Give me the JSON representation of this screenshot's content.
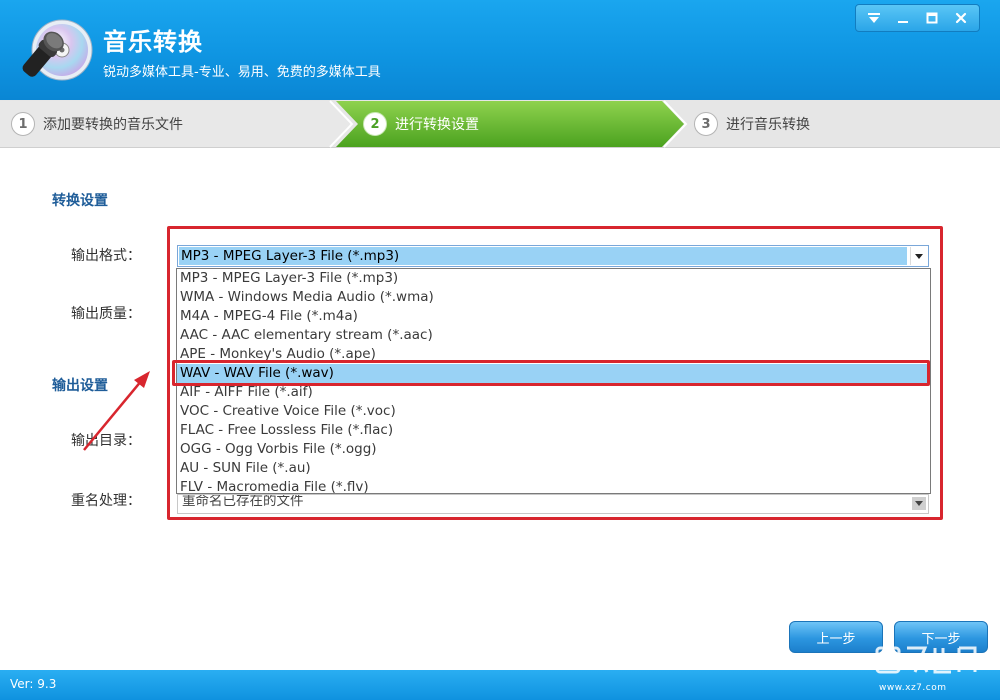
{
  "app": {
    "title": "音乐转换",
    "subtitle": "锐动多媒体工具-专业、易用、免费的多媒体工具"
  },
  "steps": [
    {
      "num": "1",
      "label": "添加要转换的音乐文件"
    },
    {
      "num": "2",
      "label": "进行转换设置"
    },
    {
      "num": "3",
      "label": "进行音乐转换"
    }
  ],
  "sections": {
    "conversion": "转换设置",
    "output": "输出设置"
  },
  "labels": {
    "format": "输出格式：",
    "quality": "输出质量：",
    "directory": "输出目录：",
    "rename": "重名处理："
  },
  "format_select": {
    "value": "MP3 - MPEG Layer-3 File (*.mp3)",
    "options": [
      "MP3 - MPEG Layer-3 File (*.mp3)",
      "WMA - Windows Media Audio (*.wma)",
      "M4A - MPEG-4 File (*.m4a)",
      "AAC - AAC elementary stream (*.aac)",
      "APE - Monkey's Audio (*.ape)",
      "WAV - WAV File (*.wav)",
      "AIF - AIFF File (*.aif)",
      "VOC - Creative Voice File (*.voc)",
      "FLAC - Free Lossless File (*.flac)",
      "OGG - Ogg Vorbis File (*.ogg)",
      "AU - SUN File (*.au)",
      "FLV - Macromedia File (*.flv)"
    ],
    "highlighted": "WAV - WAV File (*.wav)"
  },
  "rename_select": {
    "value": "重命名已存在的文件"
  },
  "buttons": {
    "prev": "上一步",
    "next": "下一步"
  },
  "status": {
    "version": "Ver: 9.3"
  },
  "watermark": {
    "text": "www.xz7.com"
  },
  "colors": {
    "header_blue": "#0f95e2",
    "active_step_green": "#5bb12f",
    "annotation_red": "#d8262e",
    "selection_blue": "#99d2f5"
  }
}
